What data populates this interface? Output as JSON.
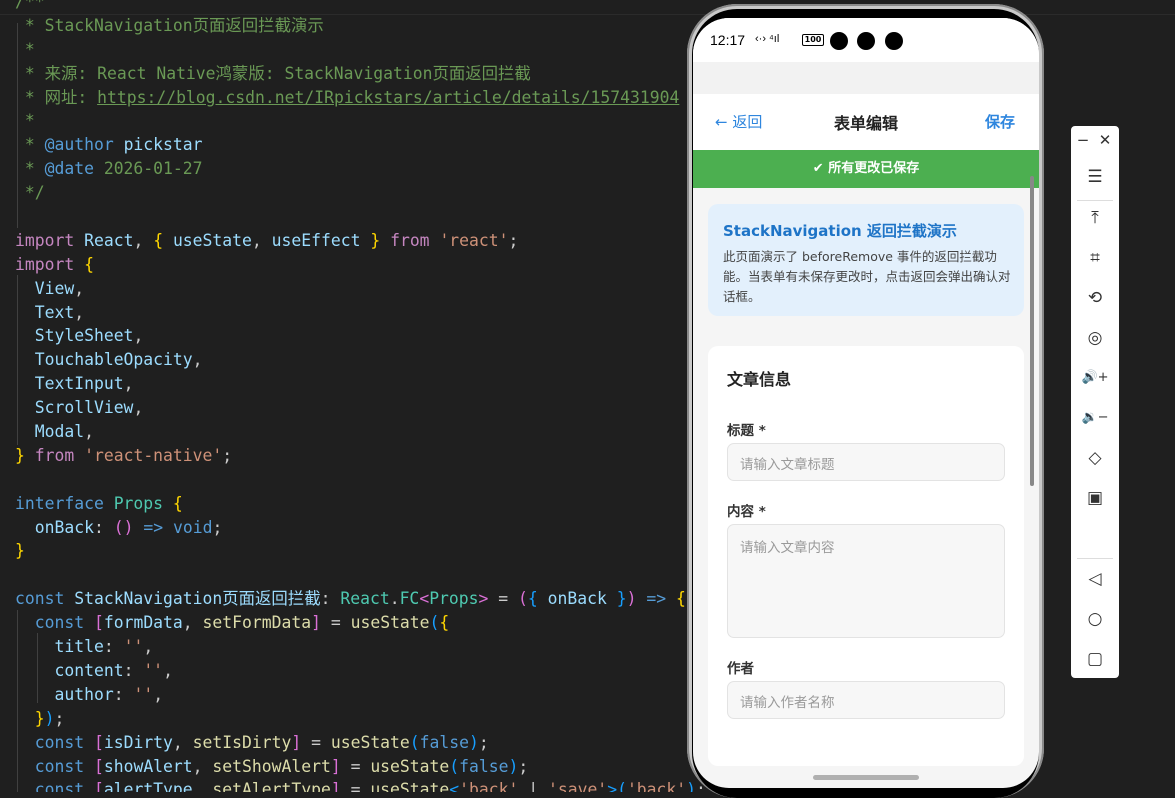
{
  "editor": {
    "lines": [
      {
        "parts": [
          {
            "c": "cm",
            "t": "/**"
          }
        ]
      },
      {
        "parts": [
          {
            "c": "cm",
            "t": " * StackNavigation页面返回拦截演示"
          }
        ]
      },
      {
        "parts": [
          {
            "c": "cm",
            "t": " *"
          }
        ]
      },
      {
        "parts": [
          {
            "c": "cm",
            "t": " * 来源: React Native鸿蒙版: StackNavigation页面返回拦截"
          }
        ]
      },
      {
        "parts": [
          {
            "c": "cm",
            "t": " * 网址: "
          },
          {
            "c": "cm ul",
            "t": "https://blog.csdn.net/IRpickstars/article/details/157431904"
          }
        ]
      },
      {
        "parts": [
          {
            "c": "cm",
            "t": " *"
          }
        ]
      },
      {
        "parts": [
          {
            "c": "cm",
            "t": " * "
          },
          {
            "c": "kw",
            "t": "@author"
          },
          {
            "c": "cm",
            "t": " "
          },
          {
            "c": "vr",
            "t": "pickstar"
          }
        ]
      },
      {
        "parts": [
          {
            "c": "cm",
            "t": " * "
          },
          {
            "c": "kw",
            "t": "@date"
          },
          {
            "c": "cm",
            "t": " 2026-01-27"
          }
        ]
      },
      {
        "parts": [
          {
            "c": "cm",
            "t": " */"
          }
        ]
      },
      {
        "parts": [
          {
            "c": "",
            "t": " "
          }
        ]
      },
      {
        "parts": [
          {
            "c": "kw2",
            "t": "import"
          },
          {
            "c": "",
            "t": " "
          },
          {
            "c": "vr",
            "t": "React"
          },
          {
            "c": "",
            "t": ", "
          },
          {
            "c": "b1",
            "t": "{"
          },
          {
            "c": "",
            "t": " "
          },
          {
            "c": "vr",
            "t": "useState"
          },
          {
            "c": "",
            "t": ", "
          },
          {
            "c": "vr",
            "t": "useEffect"
          },
          {
            "c": "",
            "t": " "
          },
          {
            "c": "b1",
            "t": "}"
          },
          {
            "c": "",
            "t": " "
          },
          {
            "c": "kw2",
            "t": "from"
          },
          {
            "c": "",
            "t": " "
          },
          {
            "c": "st",
            "t": "'react'"
          },
          {
            "c": "",
            "t": ";"
          }
        ]
      },
      {
        "parts": [
          {
            "c": "kw2",
            "t": "import"
          },
          {
            "c": "",
            "t": " "
          },
          {
            "c": "b1",
            "t": "{"
          }
        ]
      },
      {
        "parts": [
          {
            "c": "",
            "t": "  "
          },
          {
            "c": "vr",
            "t": "View"
          },
          {
            "c": "",
            "t": ","
          }
        ]
      },
      {
        "parts": [
          {
            "c": "",
            "t": "  "
          },
          {
            "c": "vr",
            "t": "Text"
          },
          {
            "c": "",
            "t": ","
          }
        ]
      },
      {
        "parts": [
          {
            "c": "",
            "t": "  "
          },
          {
            "c": "vr",
            "t": "StyleSheet"
          },
          {
            "c": "",
            "t": ","
          }
        ]
      },
      {
        "parts": [
          {
            "c": "",
            "t": "  "
          },
          {
            "c": "vr",
            "t": "TouchableOpacity"
          },
          {
            "c": "",
            "t": ","
          }
        ]
      },
      {
        "parts": [
          {
            "c": "",
            "t": "  "
          },
          {
            "c": "vr",
            "t": "TextInput"
          },
          {
            "c": "",
            "t": ","
          }
        ]
      },
      {
        "parts": [
          {
            "c": "",
            "t": "  "
          },
          {
            "c": "vr",
            "t": "ScrollView"
          },
          {
            "c": "",
            "t": ","
          }
        ]
      },
      {
        "parts": [
          {
            "c": "",
            "t": "  "
          },
          {
            "c": "vr",
            "t": "Modal"
          },
          {
            "c": "",
            "t": ","
          }
        ]
      },
      {
        "parts": [
          {
            "c": "b1",
            "t": "}"
          },
          {
            "c": "",
            "t": " "
          },
          {
            "c": "kw2",
            "t": "from"
          },
          {
            "c": "",
            "t": " "
          },
          {
            "c": "st",
            "t": "'react-native'"
          },
          {
            "c": "",
            "t": ";"
          }
        ]
      },
      {
        "parts": [
          {
            "c": "",
            "t": " "
          }
        ]
      },
      {
        "parts": [
          {
            "c": "kw",
            "t": "interface"
          },
          {
            "c": "",
            "t": " "
          },
          {
            "c": "ty",
            "t": "Props"
          },
          {
            "c": "",
            "t": " "
          },
          {
            "c": "b1",
            "t": "{"
          }
        ]
      },
      {
        "parts": [
          {
            "c": "",
            "t": "  "
          },
          {
            "c": "vr",
            "t": "onBack"
          },
          {
            "c": "",
            "t": ": "
          },
          {
            "c": "b2",
            "t": "()"
          },
          {
            "c": "",
            "t": " "
          },
          {
            "c": "kw",
            "t": "=>"
          },
          {
            "c": "",
            "t": " "
          },
          {
            "c": "kw",
            "t": "void"
          },
          {
            "c": "",
            "t": ";"
          }
        ]
      },
      {
        "parts": [
          {
            "c": "b1",
            "t": "}"
          }
        ]
      },
      {
        "parts": [
          {
            "c": "",
            "t": " "
          }
        ]
      },
      {
        "parts": [
          {
            "c": "kw",
            "t": "const"
          },
          {
            "c": "",
            "t": " "
          },
          {
            "c": "vr",
            "t": "StackNavigation页面返回拦截"
          },
          {
            "c": "",
            "t": ": "
          },
          {
            "c": "ty",
            "t": "React"
          },
          {
            "c": "",
            "t": "."
          },
          {
            "c": "ty",
            "t": "FC"
          },
          {
            "c": "b2",
            "t": "<"
          },
          {
            "c": "ty",
            "t": "Props"
          },
          {
            "c": "b2",
            "t": ">"
          },
          {
            "c": "",
            "t": " = "
          },
          {
            "c": "b2",
            "t": "("
          },
          {
            "c": "b3",
            "t": "{"
          },
          {
            "c": "",
            "t": " "
          },
          {
            "c": "vr",
            "t": "onBack"
          },
          {
            "c": "",
            "t": " "
          },
          {
            "c": "b3",
            "t": "}"
          },
          {
            "c": "b2",
            "t": ")"
          },
          {
            "c": "",
            "t": " "
          },
          {
            "c": "kw",
            "t": "=>"
          },
          {
            "c": "",
            "t": " "
          },
          {
            "c": "b1",
            "t": "{"
          }
        ]
      },
      {
        "parts": [
          {
            "c": "",
            "t": "  "
          },
          {
            "c": "kw",
            "t": "const"
          },
          {
            "c": "",
            "t": " "
          },
          {
            "c": "b2",
            "t": "["
          },
          {
            "c": "vr",
            "t": "formData"
          },
          {
            "c": "",
            "t": ", "
          },
          {
            "c": "fn",
            "t": "setFormData"
          },
          {
            "c": "b2",
            "t": "]"
          },
          {
            "c": "",
            "t": " = "
          },
          {
            "c": "fn",
            "t": "useState"
          },
          {
            "c": "b3",
            "t": "("
          },
          {
            "c": "b1",
            "t": "{"
          }
        ]
      },
      {
        "parts": [
          {
            "c": "",
            "t": "    "
          },
          {
            "c": "vr",
            "t": "title"
          },
          {
            "c": "",
            "t": ": "
          },
          {
            "c": "st",
            "t": "''"
          },
          {
            "c": "",
            "t": ","
          }
        ]
      },
      {
        "parts": [
          {
            "c": "",
            "t": "    "
          },
          {
            "c": "vr",
            "t": "content"
          },
          {
            "c": "",
            "t": ": "
          },
          {
            "c": "st",
            "t": "''"
          },
          {
            "c": "",
            "t": ","
          }
        ]
      },
      {
        "parts": [
          {
            "c": "",
            "t": "    "
          },
          {
            "c": "vr",
            "t": "author"
          },
          {
            "c": "",
            "t": ": "
          },
          {
            "c": "st",
            "t": "''"
          },
          {
            "c": "",
            "t": ","
          }
        ]
      },
      {
        "parts": [
          {
            "c": "",
            "t": "  "
          },
          {
            "c": "b1",
            "t": "}"
          },
          {
            "c": "b3",
            "t": ")"
          },
          {
            "c": "",
            "t": ";"
          }
        ]
      },
      {
        "parts": [
          {
            "c": "",
            "t": "  "
          },
          {
            "c": "kw",
            "t": "const"
          },
          {
            "c": "",
            "t": " "
          },
          {
            "c": "b2",
            "t": "["
          },
          {
            "c": "vr",
            "t": "isDirty"
          },
          {
            "c": "",
            "t": ", "
          },
          {
            "c": "fn",
            "t": "setIsDirty"
          },
          {
            "c": "b2",
            "t": "]"
          },
          {
            "c": "",
            "t": " = "
          },
          {
            "c": "fn",
            "t": "useState"
          },
          {
            "c": "b3",
            "t": "("
          },
          {
            "c": "kw",
            "t": "false"
          },
          {
            "c": "b3",
            "t": ")"
          },
          {
            "c": "",
            "t": ";"
          }
        ]
      },
      {
        "parts": [
          {
            "c": "",
            "t": "  "
          },
          {
            "c": "kw",
            "t": "const"
          },
          {
            "c": "",
            "t": " "
          },
          {
            "c": "b2",
            "t": "["
          },
          {
            "c": "vr",
            "t": "showAlert"
          },
          {
            "c": "",
            "t": ", "
          },
          {
            "c": "fn",
            "t": "setShowAlert"
          },
          {
            "c": "b2",
            "t": "]"
          },
          {
            "c": "",
            "t": " = "
          },
          {
            "c": "fn",
            "t": "useState"
          },
          {
            "c": "b3",
            "t": "("
          },
          {
            "c": "kw",
            "t": "false"
          },
          {
            "c": "b3",
            "t": ")"
          },
          {
            "c": "",
            "t": ";"
          }
        ]
      },
      {
        "parts": [
          {
            "c": "",
            "t": "  "
          },
          {
            "c": "kw",
            "t": "const"
          },
          {
            "c": "",
            "t": " "
          },
          {
            "c": "b2",
            "t": "["
          },
          {
            "c": "vr",
            "t": "alertType"
          },
          {
            "c": "",
            "t": ", "
          },
          {
            "c": "fn",
            "t": "setAlertType"
          },
          {
            "c": "b2",
            "t": "]"
          },
          {
            "c": "",
            "t": " = "
          },
          {
            "c": "fn",
            "t": "useState"
          },
          {
            "c": "b3",
            "t": "<"
          },
          {
            "c": "st",
            "t": "'back'"
          },
          {
            "c": "",
            "t": " | "
          },
          {
            "c": "st",
            "t": "'save'"
          },
          {
            "c": "b3",
            "t": ">"
          },
          {
            "c": "b3",
            "t": "("
          },
          {
            "c": "st",
            "t": "'back'"
          },
          {
            "c": "b3",
            "t": ")"
          },
          {
            "c": "",
            "t": ";"
          }
        ]
      }
    ]
  },
  "phone": {
    "status": {
      "time": "12:17",
      "icons": "‹·›  ⁴ıl",
      "battery": "100"
    },
    "nav": {
      "back": "← 返回",
      "title": "表单编辑",
      "save": "保存"
    },
    "banner": "✔ 所有更改已保存",
    "info": {
      "title": "StackNavigation 返回拦截演示",
      "text": "此页面演示了 beforeRemove 事件的返回拦截功能。当表单有未保存更改时，点击返回会弹出确认对话框。"
    },
    "form": {
      "title": "文章信息",
      "fields": [
        {
          "label": "标题 *",
          "placeholder": "请输入文章标题"
        },
        {
          "label": "内容 *",
          "placeholder": "请输入文章内容"
        },
        {
          "label": "作者",
          "placeholder": "请输入作者名称"
        }
      ]
    }
  },
  "toolbar": {
    "minimize": "−",
    "close": "✕",
    "menu": "☰",
    "pin_top": "⤒",
    "crop": "⌗",
    "rotate": "⟲",
    "screenshot": "◎",
    "volume_up": "🔊+",
    "volume_down": "🔉−",
    "shake": "◇",
    "multi_screen": "▣",
    "back": "◁",
    "home": "○",
    "recents": "▢"
  }
}
